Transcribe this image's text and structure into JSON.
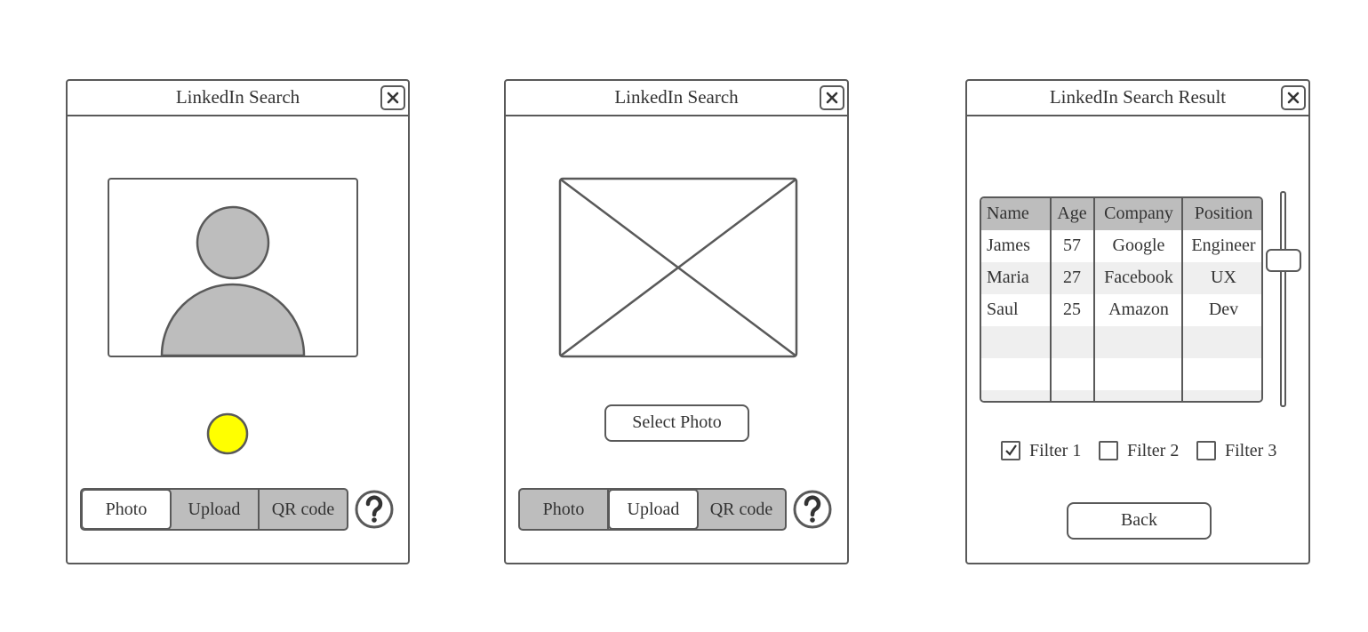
{
  "colors": {
    "stroke": "#595959",
    "fill_gray": "#bdbdbd",
    "row_alt": "#efefef",
    "capture_button": "#ffff00"
  },
  "window1": {
    "title": "LinkedIn Search",
    "close_icon": "close-icon",
    "preview_icon": "user-silhouette-icon",
    "capture_icon": "capture-circle-icon",
    "tabs": [
      {
        "label": "Photo",
        "selected": true
      },
      {
        "label": "Upload",
        "selected": false
      },
      {
        "label": "QR code",
        "selected": false
      }
    ],
    "help_icon": "question-mark-icon"
  },
  "window2": {
    "title": "LinkedIn Search",
    "close_icon": "close-icon",
    "image_placeholder_icon": "image-placeholder-icon",
    "select_photo_label": "Select Photo",
    "tabs": [
      {
        "label": "Photo",
        "selected": false
      },
      {
        "label": "Upload",
        "selected": true
      },
      {
        "label": "QR code",
        "selected": false
      }
    ],
    "help_icon": "question-mark-icon"
  },
  "window3": {
    "title": "LinkedIn Search Result",
    "close_icon": "close-icon",
    "table": {
      "columns": [
        "Name",
        "Age",
        "Company",
        "Position"
      ],
      "rows": [
        [
          "James",
          "57",
          "Google",
          "Engineer"
        ],
        [
          "Maria",
          "27",
          "Facebook",
          "UX"
        ],
        [
          "Saul",
          "25",
          "Amazon",
          "Dev"
        ]
      ]
    },
    "filters": [
      {
        "label": "Filter 1",
        "checked": true
      },
      {
        "label": "Filter 2",
        "checked": false
      },
      {
        "label": "Filter 3",
        "checked": false
      }
    ],
    "back_label": "Back"
  }
}
